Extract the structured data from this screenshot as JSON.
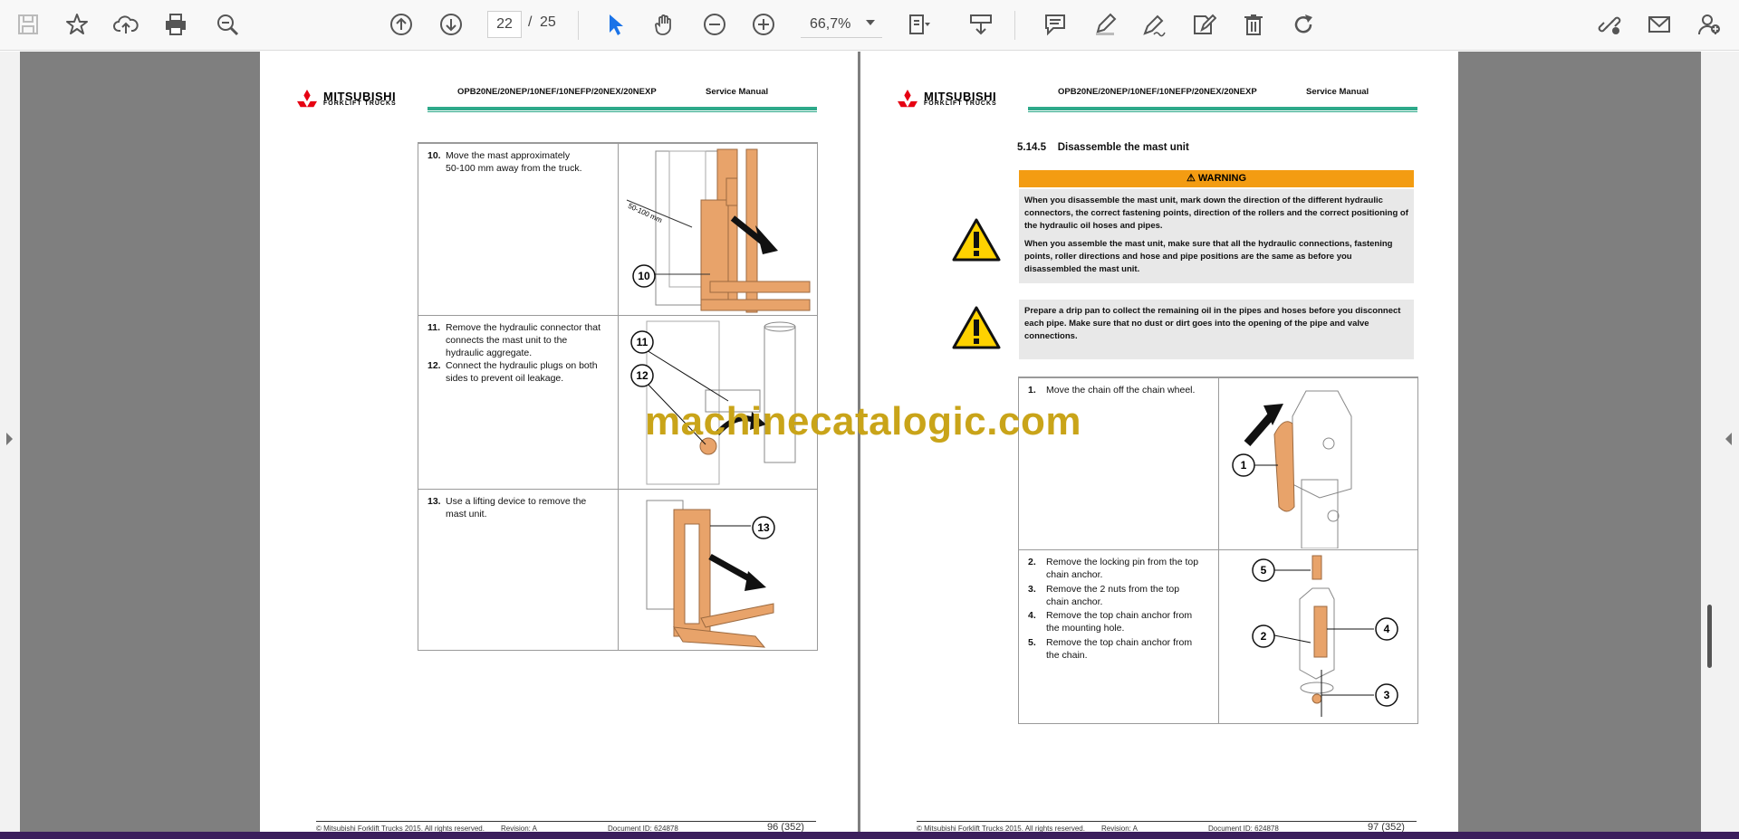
{
  "toolbar": {
    "icons": [
      "save-icon",
      "bookmark-star-icon",
      "upload-cloud-icon",
      "print-icon",
      "zoom-search-icon",
      "page-up-icon",
      "page-down-icon",
      "select-arrow-icon",
      "hand-tool-icon",
      "zoom-out-icon",
      "zoom-in-icon",
      "fit-page-icon",
      "scroll-mode-icon",
      "comment-icon",
      "highlight-pen-icon",
      "draw-pen-icon",
      "fill-sign-icon",
      "delete-icon",
      "rotate-icon",
      "share-link-icon",
      "email-icon",
      "add-user-icon"
    ],
    "current_page": "22",
    "page_separator": "/",
    "total_pages": "25",
    "zoom": "66,7%"
  },
  "left_page": {
    "brand": "MITSUBISHI",
    "brand_sub": "FORKLIFT TRUCKS",
    "model": "OPB20NE/20NEP/10NEF/10NEFP/20NEX/20NEXP",
    "doc_type": "Service Manual",
    "steps": [
      {
        "num": "10.",
        "text": "Move the mast approximately\n50-100 mm away from the truck."
      },
      {
        "num": "11.",
        "text": "Remove the hydraulic connector that\nconnects the mast unit to the\nhydraulic aggregate."
      },
      {
        "num": "12.",
        "text": "Connect the hydraulic plugs on both\nsides to prevent oil leakage."
      },
      {
        "num": "13.",
        "text": "Use a lifting device to remove the\nmast unit."
      }
    ],
    "callouts": [
      "10",
      "11",
      "12",
      "13"
    ],
    "dim_label": "50-100 mm",
    "footer": {
      "copyright": "© Mitsubishi Forklift Trucks 2015. All rights reserved.",
      "revision": "Revision: A",
      "document": "Document ID: 624878",
      "page": "96 (352)"
    }
  },
  "right_page": {
    "brand": "MITSUBISHI",
    "brand_sub": "FORKLIFT TRUCKS",
    "model": "OPB20NE/20NEP/10NEF/10NEFP/20NEX/20NEXP",
    "doc_type": "Service Manual",
    "section_title": "5.14.5    Disassemble the mast unit",
    "warning_label": "WARNING",
    "warning_1a": "When you disassemble the mast unit, mark down the direction of the different hydraulic connectors, the correct fastening points, direction of the rollers and the correct positioning of the hydraulic oil hoses and pipes.",
    "warning_1b": "When you assemble the mast unit, make sure that all the hydraulic connections, fastening points, roller directions and hose and pipe positions are the same as before you disassembled the mast unit.",
    "warning_2": "Prepare a drip pan to collect the remaining oil in the pipes and hoses before you disconnect each pipe. Make sure that no dust or dirt goes into the opening of the pipe and valve connections.",
    "steps": [
      {
        "num": "1.",
        "text": "Move the chain off the chain wheel."
      },
      {
        "num": "2.",
        "text": "Remove the locking pin from the top\nchain anchor."
      },
      {
        "num": "3.",
        "text": "Remove the 2 nuts from the top\nchain anchor."
      },
      {
        "num": "4.",
        "text": "Remove the top chain anchor from\nthe mounting hole."
      },
      {
        "num": "5.",
        "text": "Remove the top chain anchor from\nthe chain."
      }
    ],
    "callouts": [
      "1",
      "5",
      "4",
      "2",
      "3"
    ],
    "footer": {
      "copyright": "© Mitsubishi Forklift Trucks 2015. All rights reserved.",
      "revision": "Revision: A",
      "document": "Document ID: 624878",
      "page": "97 (352)"
    }
  },
  "watermark": "machinecatalogic.com",
  "colors": {
    "accent_green": "#2ea98a",
    "warning_orange": "#f39c12",
    "part_orange": "#e8a36a",
    "select_blue": "#1a73e8",
    "brand_red": "#e60012"
  }
}
